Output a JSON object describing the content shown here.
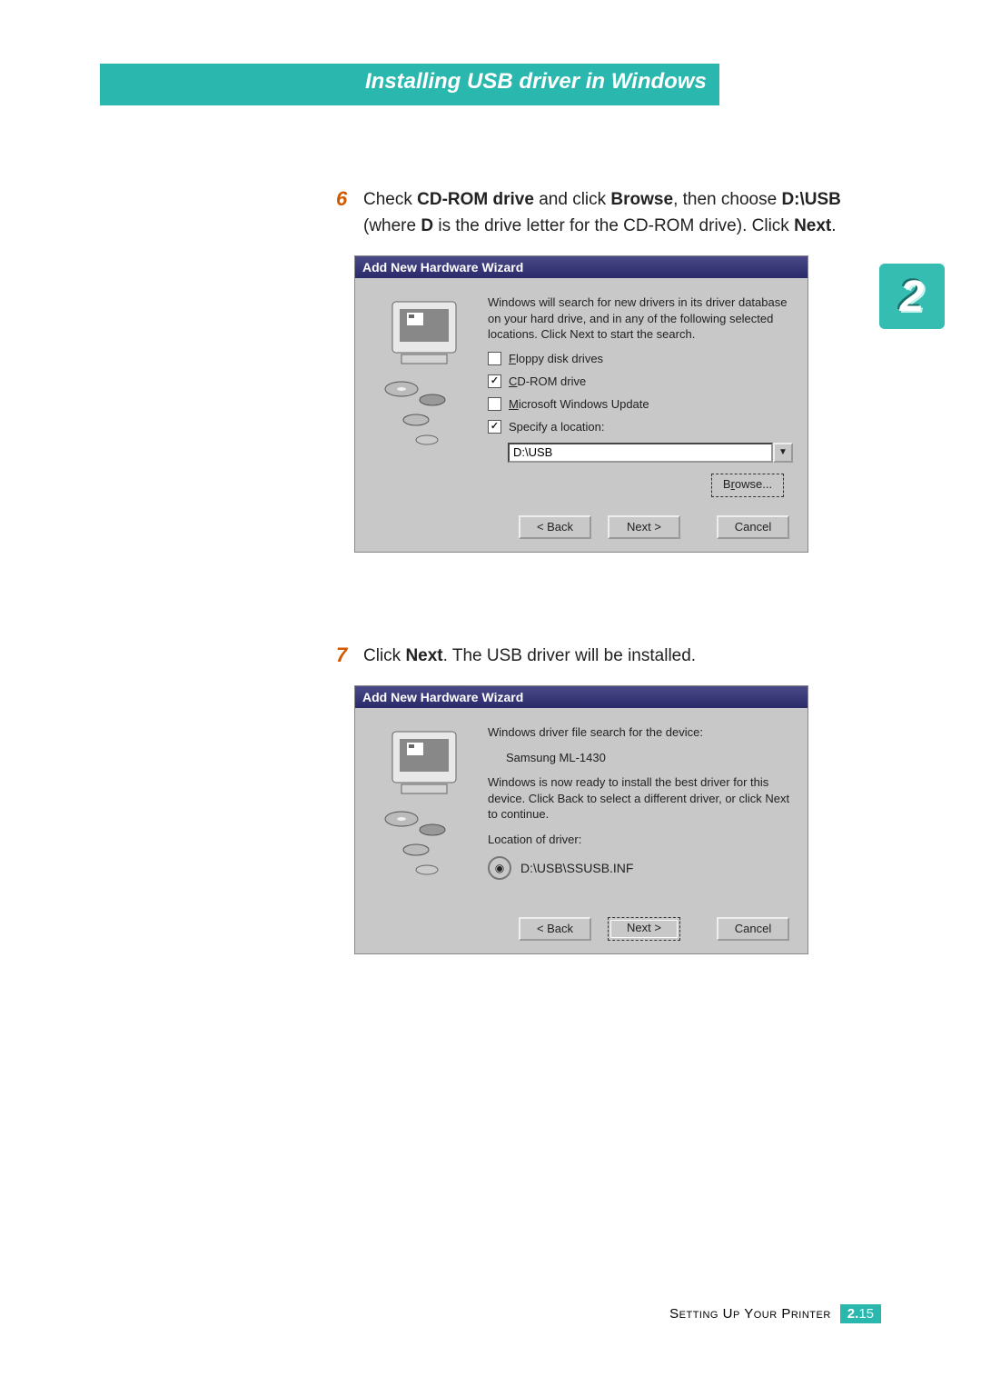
{
  "header": {
    "title": "Installing USB driver in Windows"
  },
  "side_tab": "2",
  "steps": {
    "s6": {
      "num": "6",
      "line1_a": "Check ",
      "line1_b": "CD-ROM drive",
      "line1_c": " and click ",
      "line1_d": "Browse",
      "line1_e": ", then choose ",
      "line1_f": "D:\\USB",
      "line2_a": "(where ",
      "line2_b": "D",
      "line2_c": " is the drive letter for the CD-ROM drive). Click ",
      "line2_d": "Next",
      "line2_e": "."
    },
    "s7": {
      "num": "7",
      "line_a": "Click ",
      "line_b": "Next",
      "line_c": ". The USB driver will be installed."
    }
  },
  "dialog1": {
    "title": "Add New Hardware Wizard",
    "intro": "Windows will search for new drivers in its driver database on your hard drive, and in any of the following selected locations. Click Next to start the search.",
    "opt_floppy": "Floppy disk drives",
    "opt_cdrom": "CD-ROM drive",
    "opt_update": "Microsoft Windows Update",
    "opt_specify": "Specify a location:",
    "location_value": "D:\\USB",
    "browse": "Browse...",
    "back": "< Back",
    "next": "Next >",
    "cancel": "Cancel",
    "underline": {
      "floppy": "F",
      "cdrom": "C",
      "update": "M",
      "specify": "l",
      "browse": "r",
      "back": "B"
    }
  },
  "dialog2": {
    "title": "Add New Hardware Wizard",
    "search_for": "Windows driver file search for the device:",
    "device_name": "Samsung ML-1430",
    "ready": "Windows is now ready to install the best driver for this device. Click Back to select a different driver, or click Next to continue.",
    "loc_label": "Location of driver:",
    "loc_value": "D:\\USB\\SSUSB.INF",
    "back": "< Back",
    "next": "Next >",
    "cancel": "Cancel"
  },
  "footer": {
    "chapter_name": "Setting Up Your Printer",
    "page_major": "2.",
    "page_minor": "15"
  }
}
